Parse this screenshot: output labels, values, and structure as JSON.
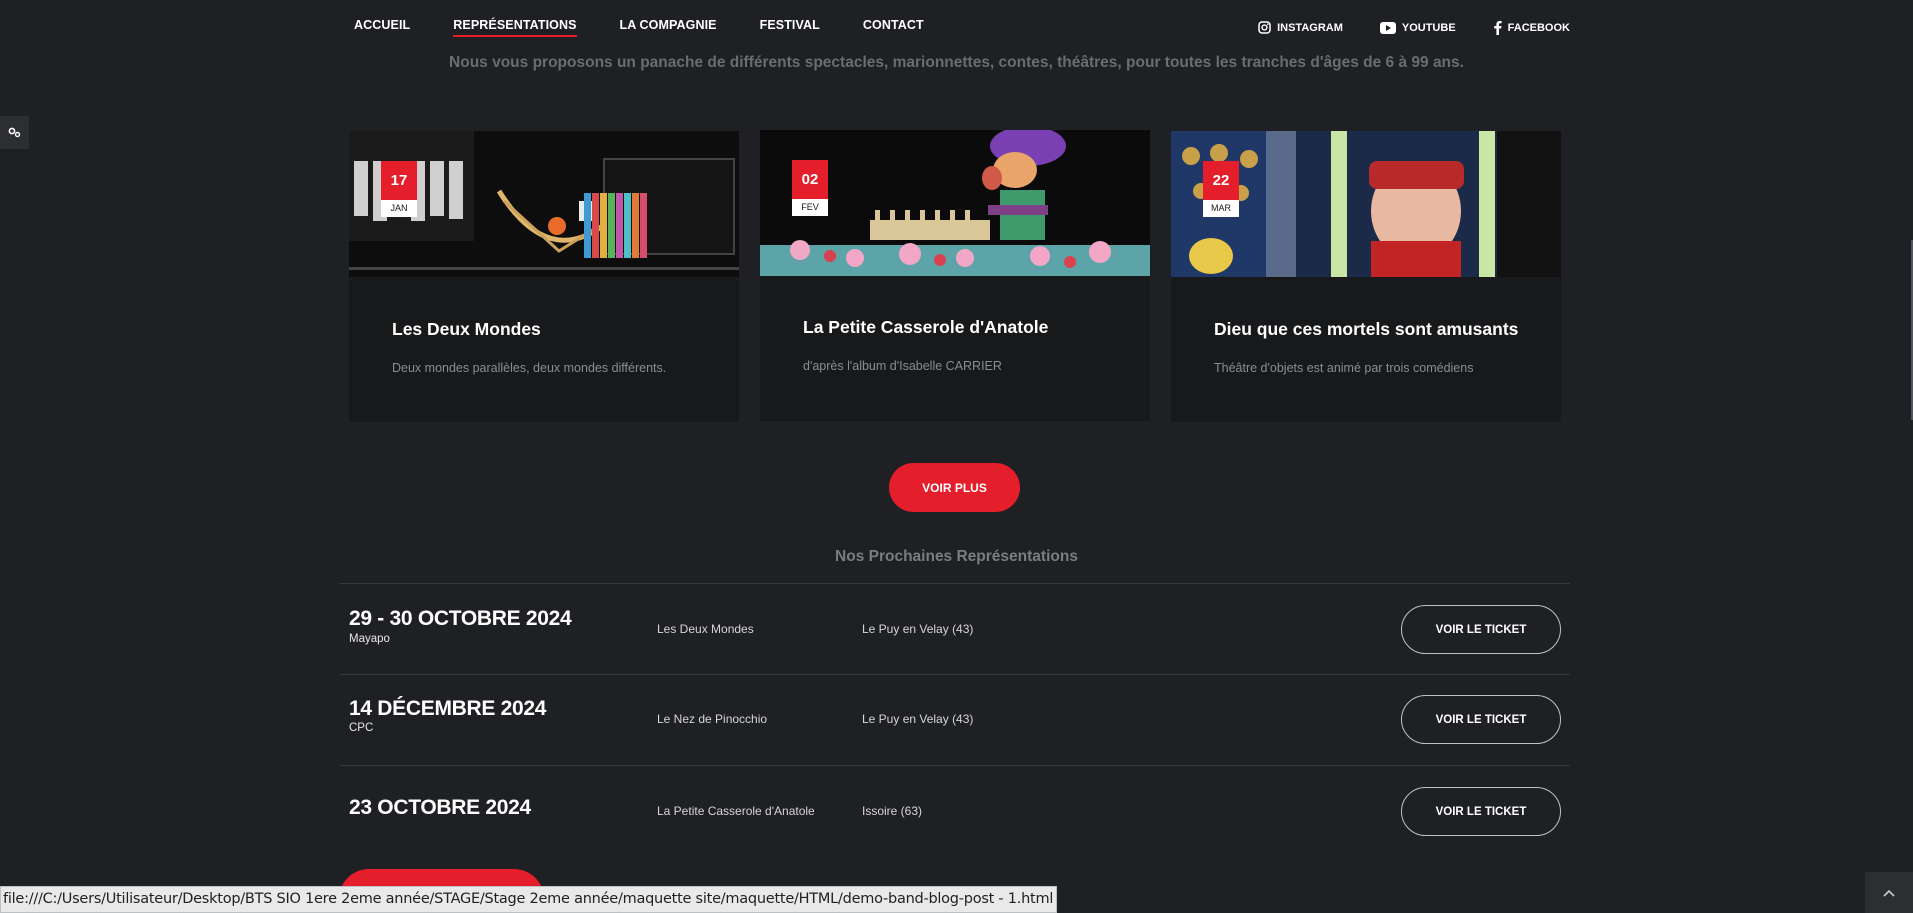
{
  "nav": {
    "items": [
      {
        "label": "ACCUEIL",
        "active": false
      },
      {
        "label": "REPRÉSENTATIONS",
        "active": true
      },
      {
        "label": "LA COMPAGNIE",
        "active": false
      },
      {
        "label": "FESTIVAL",
        "active": false
      },
      {
        "label": "CONTACT",
        "active": false
      }
    ],
    "social": [
      {
        "label": "INSTAGRAM",
        "icon": "instagram-icon"
      },
      {
        "label": "YOUTUBE",
        "icon": "youtube-icon"
      },
      {
        "label": "FACEBOOK",
        "icon": "facebook-icon"
      }
    ]
  },
  "intro": {
    "subtitle": "Nous vous proposons un panache de différents spectacles, marionnettes, contes, théâtres, pour toutes les tranches d'âges de 6 à 99 ans."
  },
  "cards": [
    {
      "day": "17",
      "month": "JAN",
      "title": "Les Deux Mondes",
      "description": "Deux mondes parallèles, deux mondes différents."
    },
    {
      "day": "02",
      "month": "FEV",
      "title": "La Petite Casserole d'Anatole",
      "description": "d'après l'album d'Isabelle CARRIER"
    },
    {
      "day": "22",
      "month": "MAR",
      "title": "Dieu que ces mortels sont amusants",
      "description": "Théâtre d'objets est animé par trois comédiens"
    }
  ],
  "more_button": {
    "label": "VOIR PLUS"
  },
  "upcoming": {
    "title": "Nos Prochaines Représentations",
    "rows": [
      {
        "date": "29 - 30 OCTOBRE 2024",
        "venue": "Mayapo",
        "show": "Les Deux Mondes",
        "city": "Le Puy en Velay (43)",
        "button": "VOIR LE TICKET"
      },
      {
        "date": "14 DÉCEMBRE 2024",
        "venue": "CPC",
        "show": "Le Nez de Pinocchio",
        "city": "Le Puy en Velay (43)",
        "button": "VOIR LE TICKET"
      },
      {
        "date": "23 OCTOBRE 2024",
        "venue": "",
        "show": "La Petite Casserole d'Anatole",
        "city": "Issoire (63)",
        "button": "VOIR LE TICKET"
      }
    ]
  },
  "status_bar": {
    "url": "file:///C:/Users/Utilisateur/Desktop/BTS SIO 1ere 2eme année/STAGE/Stage 2eme année/maquette site/maquette/HTML/demo-band-blog-post - 1.html"
  },
  "colors": {
    "accent": "#e41e2b",
    "background": "#1f2023",
    "card": "#18191b"
  }
}
